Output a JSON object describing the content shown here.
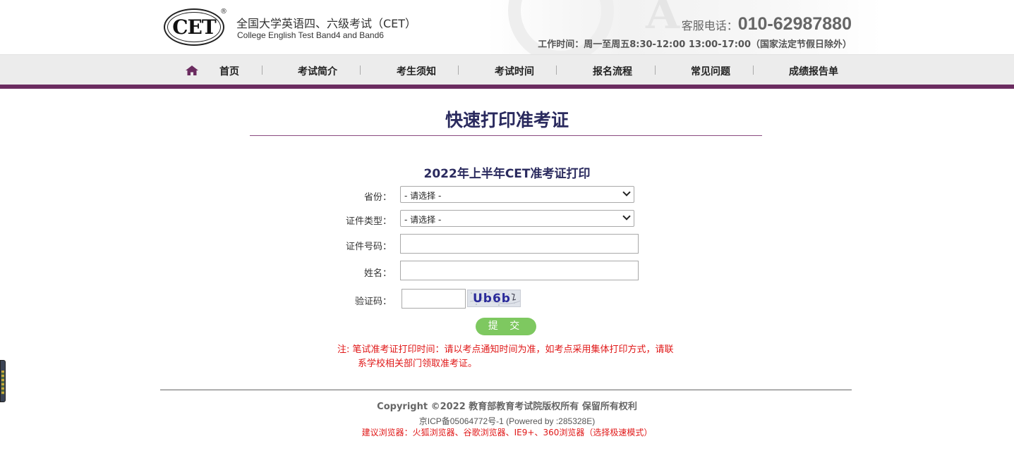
{
  "header": {
    "logo_text": "CET",
    "logo_reg": "®",
    "title": "全国大学英语四、六级考试（CET）",
    "subtitle": "College English Test Band4 and Band6",
    "hotline_label": "客服电话：",
    "hotline_number": "010-62987880",
    "work_hours": "工作时间：周一至周五8:30-12:00 13:00-17:00（国家法定节假日除外）"
  },
  "nav": {
    "home_icon": "home-icon",
    "items": [
      {
        "label": "首页"
      },
      {
        "label": "考试简介"
      },
      {
        "label": "考生须知"
      },
      {
        "label": "考试时间"
      },
      {
        "label": "报名流程"
      },
      {
        "label": "常见问题"
      },
      {
        "label": "成绩报告单"
      }
    ]
  },
  "main": {
    "page_title": "快速打印准考证",
    "form_title": "2022年上半年CET准考证打印",
    "fields": {
      "province_label": "省份：",
      "province_value": "- 请选择 -",
      "id_type_label": "证件类型：",
      "id_type_value": "- 请选择 -",
      "id_number_label": "证件号码：",
      "id_number_value": "",
      "name_label": "姓名：",
      "name_value": "",
      "captcha_label": "验证码：",
      "captcha_value": "",
      "captcha_image_text": "Ub6b"
    },
    "submit_label": "提 交",
    "note_line1": "注:  笔试准考证打印时间：请以考点通知时间为准，如考点采用集体打印方式，请联",
    "note_line2": "系学校相关部门领取准考证。"
  },
  "footer": {
    "copyright": "Copyright ©2022 教育部教育考试院版权所有 保留所有权利",
    "icp": "京ICP备05064772号-1 (Powered by :285328E)",
    "browser_tip": "建议浏览器：火狐浏览器、谷歌浏览器、IE9+、360浏览器（选择极速模式）"
  },
  "colors": {
    "nav_accent": "#6b2c60",
    "title_navy": "#2a2a5e",
    "submit_green": "#7ec860",
    "note_red": "#e01818"
  }
}
